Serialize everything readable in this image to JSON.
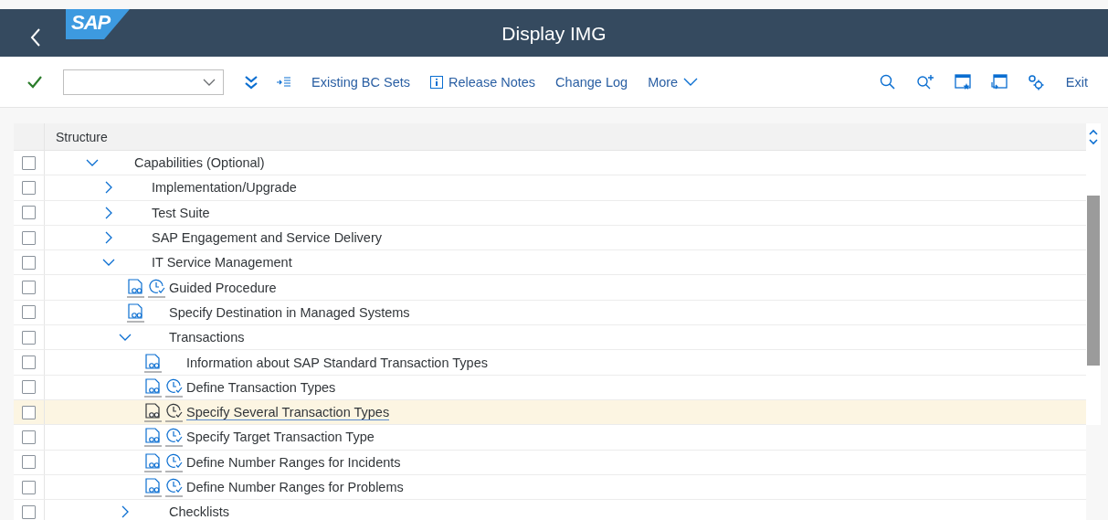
{
  "header": {
    "logo": "SAP",
    "title": "Display IMG"
  },
  "toolbar": {
    "items": [
      {
        "kind": "text",
        "label": "Existing BC Sets"
      },
      {
        "kind": "info",
        "label": "Release Notes"
      },
      {
        "kind": "text",
        "label": "Change Log"
      },
      {
        "kind": "menu",
        "label": "More"
      }
    ],
    "exit": "Exit"
  },
  "structure": {
    "column": "Structure",
    "nodes": [
      {
        "kind": "folder",
        "label": "Capabilities (Optional)",
        "expanded": true,
        "checked": false,
        "selected": false,
        "children": [
          {
            "kind": "folder",
            "label": "Implementation/Upgrade",
            "expanded": false,
            "checked": false,
            "selected": false
          },
          {
            "kind": "folder",
            "label": "Test Suite",
            "expanded": false,
            "checked": false,
            "selected": false
          },
          {
            "kind": "folder",
            "label": "SAP Engagement and Service Delivery",
            "expanded": false,
            "checked": false,
            "selected": false
          },
          {
            "kind": "folder",
            "label": "IT Service Management",
            "expanded": true,
            "checked": false,
            "selected": false,
            "children": [
              {
                "kind": "activity",
                "label": "Guided Procedure",
                "clock": true,
                "checked": false,
                "selected": false
              },
              {
                "kind": "activity",
                "label": "Specify Destination in Managed Systems",
                "clock": false,
                "checked": false,
                "selected": false
              },
              {
                "kind": "folder",
                "label": "Transactions",
                "expanded": true,
                "checked": false,
                "selected": false,
                "children": [
                  {
                    "kind": "activity",
                    "label": "Information about SAP Standard Transaction Types",
                    "clock": false,
                    "checked": false,
                    "selected": false
                  },
                  {
                    "kind": "activity",
                    "label": "Define Transaction Types",
                    "clock": true,
                    "checked": false,
                    "selected": false
                  },
                  {
                    "kind": "activity",
                    "label": "Specify Several Transaction Types",
                    "clock": true,
                    "checked": false,
                    "selected": true
                  },
                  {
                    "kind": "activity",
                    "label": "Specify Target Transaction Type",
                    "clock": true,
                    "checked": false,
                    "selected": false
                  },
                  {
                    "kind": "activity",
                    "label": "Define Number Ranges for Incidents",
                    "clock": true,
                    "checked": false,
                    "selected": false
                  },
                  {
                    "kind": "activity",
                    "label": "Define Number Ranges for Problems",
                    "clock": true,
                    "checked": false,
                    "selected": false
                  }
                ]
              },
              {
                "kind": "folder",
                "label": "Checklists",
                "expanded": false,
                "checked": false,
                "selected": false
              }
            ]
          }
        ]
      }
    ]
  }
}
